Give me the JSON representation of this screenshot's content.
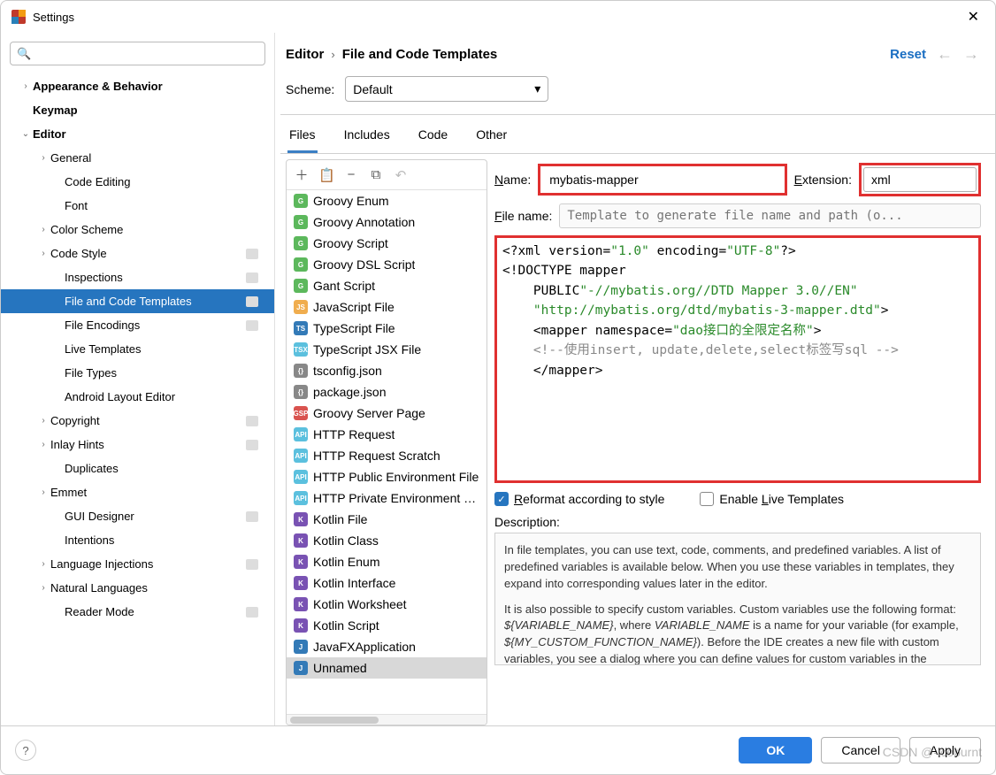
{
  "window": {
    "title": "Settings"
  },
  "search": {
    "placeholder": ""
  },
  "tree": [
    {
      "label": "Appearance & Behavior",
      "depth": 0,
      "chevron": "›",
      "bold": true
    },
    {
      "label": "Keymap",
      "depth": 0,
      "chevron": "",
      "bold": true
    },
    {
      "label": "Editor",
      "depth": 0,
      "chevron": "⌄",
      "bold": true
    },
    {
      "label": "General",
      "depth": 1,
      "chevron": "›"
    },
    {
      "label": "Code Editing",
      "depth": 2
    },
    {
      "label": "Font",
      "depth": 2
    },
    {
      "label": "Color Scheme",
      "depth": 1,
      "chevron": "›"
    },
    {
      "label": "Code Style",
      "depth": 1,
      "chevron": "›",
      "badge": true
    },
    {
      "label": "Inspections",
      "depth": 2,
      "badge": true
    },
    {
      "label": "File and Code Templates",
      "depth": 2,
      "selected": true,
      "badge": true
    },
    {
      "label": "File Encodings",
      "depth": 2,
      "badge": true
    },
    {
      "label": "Live Templates",
      "depth": 2
    },
    {
      "label": "File Types",
      "depth": 2
    },
    {
      "label": "Android Layout Editor",
      "depth": 2
    },
    {
      "label": "Copyright",
      "depth": 1,
      "chevron": "›",
      "badge": true
    },
    {
      "label": "Inlay Hints",
      "depth": 1,
      "chevron": "›",
      "badge": true
    },
    {
      "label": "Duplicates",
      "depth": 2
    },
    {
      "label": "Emmet",
      "depth": 1,
      "chevron": "›"
    },
    {
      "label": "GUI Designer",
      "depth": 2,
      "badge": true
    },
    {
      "label": "Intentions",
      "depth": 2
    },
    {
      "label": "Language Injections",
      "depth": 1,
      "chevron": "›",
      "badge": true
    },
    {
      "label": "Natural Languages",
      "depth": 1,
      "chevron": "›"
    },
    {
      "label": "Reader Mode",
      "depth": 2,
      "badge": true
    }
  ],
  "breadcrumb": {
    "seg1": "Editor",
    "seg2": "File and Code Templates",
    "reset": "Reset"
  },
  "scheme": {
    "label": "Scheme:",
    "value": "Default"
  },
  "tabs": [
    "Files",
    "Includes",
    "Code",
    "Other"
  ],
  "templates": [
    {
      "icon": "g",
      "label": "Groovy Enum"
    },
    {
      "icon": "g",
      "label": "Groovy Annotation"
    },
    {
      "icon": "g",
      "label": "Groovy Script"
    },
    {
      "icon": "g",
      "label": "Groovy DSL Script"
    },
    {
      "icon": "g",
      "label": "Gant Script"
    },
    {
      "icon": "js",
      "label": "JavaScript File"
    },
    {
      "icon": "ts",
      "label": "TypeScript File"
    },
    {
      "icon": "tsx",
      "label": "TypeScript JSX File"
    },
    {
      "icon": "json",
      "label": "tsconfig.json"
    },
    {
      "icon": "json",
      "label": "package.json"
    },
    {
      "icon": "gsp",
      "label": "Groovy Server Page"
    },
    {
      "icon": "api",
      "label": "HTTP Request"
    },
    {
      "icon": "api",
      "label": "HTTP Request Scratch"
    },
    {
      "icon": "api",
      "label": "HTTP Public Environment File"
    },
    {
      "icon": "api",
      "label": "HTTP Private Environment File"
    },
    {
      "icon": "k",
      "label": "Kotlin File"
    },
    {
      "icon": "k",
      "label": "Kotlin Class"
    },
    {
      "icon": "k",
      "label": "Kotlin Enum"
    },
    {
      "icon": "k",
      "label": "Kotlin Interface"
    },
    {
      "icon": "k",
      "label": "Kotlin Worksheet"
    },
    {
      "icon": "k",
      "label": "Kotlin Script"
    },
    {
      "icon": "j",
      "label": "JavaFXApplication"
    },
    {
      "icon": "j",
      "label": "Unnamed",
      "selected": true
    }
  ],
  "form": {
    "name_label": "Name:",
    "name_value": "mybatis-mapper",
    "ext_label": "Extension:",
    "ext_value": "xml",
    "filename_label": "File name:",
    "filename_placeholder": "Template to generate file name and path (o..."
  },
  "code": {
    "l1a": "<?xml version=",
    "l1b": "\"1.0\"",
    "l1c": " encoding=",
    "l1d": "\"UTF-8\"",
    "l1e": "?>",
    "l2": "<!DOCTYPE mapper",
    "l3a": "    PUBLIC",
    "l3b": "\"-//mybatis.org//DTD Mapper 3.0//EN\"",
    "l4a": "    ",
    "l4b": "\"http://mybatis.org/dtd/mybatis-3-mapper.dtd\"",
    "l4c": ">",
    "l5a": "    <mapper namespace=",
    "l5b": "\"dao接口的全限定名称\"",
    "l5c": ">",
    "l6": "    <!--使用insert, update,delete,select标签写sql -->",
    "l7": "    </mapper>"
  },
  "opts": {
    "reformat": "Reformat according to style",
    "live": "Enable Live Templates"
  },
  "desc": {
    "label": "Description:",
    "p1": "In file templates, you can use text, code, comments, and predefined variables. A list of predefined variables is available below. When you use these variables in templates, they expand into corresponding values later in the editor.",
    "p2a": "It is also possible to specify custom variables. Custom variables use the following format: ",
    "p2v1": "${VARIABLE_NAME}",
    "p2b": ", where ",
    "p2v2": "VARIABLE_NAME",
    "p2c": " is a name for your variable (for example, ",
    "p2v3": "${MY_CUSTOM_FUNCTION_NAME}",
    "p2d": "). Before the IDE creates a new file with custom variables, you see a dialog where you can define values for custom variables in the template."
  },
  "footer": {
    "ok": "OK",
    "cancel": "Cancel",
    "apply": "Apply"
  },
  "watermark": "CSDN @-iceburnt"
}
